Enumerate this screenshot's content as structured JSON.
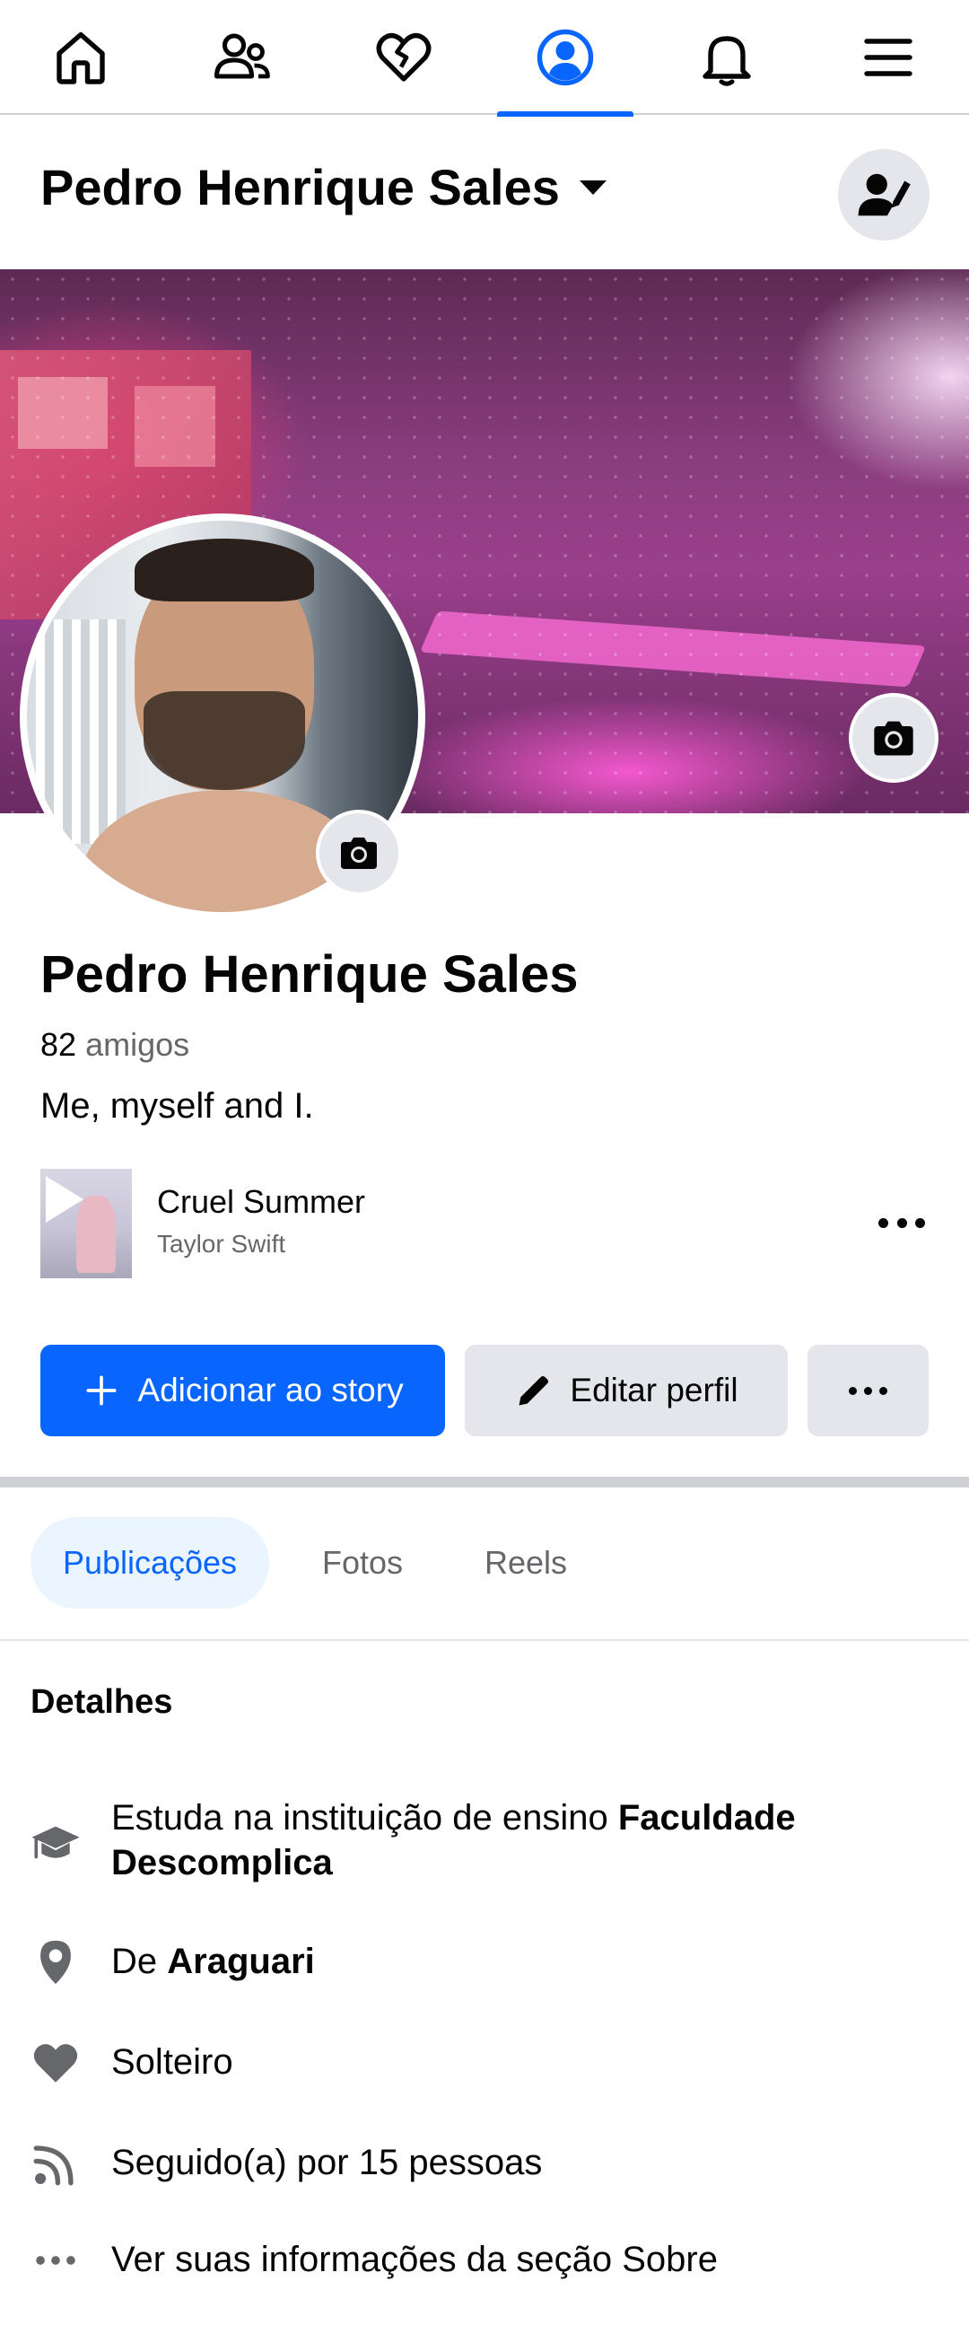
{
  "nav": {
    "items": [
      {
        "name": "home",
        "icon": "home-icon"
      },
      {
        "name": "friends",
        "icon": "friends-icon"
      },
      {
        "name": "dating",
        "icon": "heart-icon"
      },
      {
        "name": "profile",
        "icon": "profile-icon",
        "active": true
      },
      {
        "name": "notifications",
        "icon": "bell-icon"
      },
      {
        "name": "menu",
        "icon": "menu-icon"
      }
    ]
  },
  "header": {
    "name": "Pedro Henrique Sales"
  },
  "profile": {
    "name": "Pedro Henrique Sales",
    "friends_count": "82",
    "friends_label": "amigos",
    "bio": "Me, myself and I."
  },
  "music": {
    "title": "Cruel Summer",
    "artist": "Taylor Swift"
  },
  "actions": {
    "add_story": "Adicionar ao story",
    "edit_profile": "Editar perfil"
  },
  "tabs": [
    {
      "label": "Publicações",
      "active": true
    },
    {
      "label": "Fotos"
    },
    {
      "label": "Reels"
    }
  ],
  "details": {
    "title": "Detalhes",
    "education_prefix": "Estuda na instituição de ensino ",
    "education_school": "Faculdade Descomplica",
    "from_prefix": "De ",
    "from_city": "Araguari",
    "relationship": "Solteiro",
    "followers": "Seguido(a) por 15 pessoas",
    "about_link": "Ver suas informações da seção Sobre"
  },
  "colors": {
    "accent": "#0866ff",
    "text": "#050505",
    "secondary_text": "#65676b",
    "button_gray": "#e4e6eb",
    "tab_active_bg": "#ebf5ff"
  }
}
